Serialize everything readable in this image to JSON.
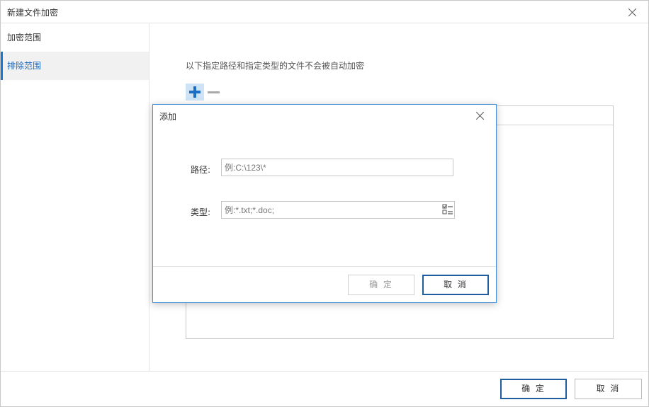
{
  "window": {
    "title": "新建文件加密"
  },
  "sidebar": {
    "items": [
      {
        "label": "加密范围"
      },
      {
        "label": "排除范围"
      }
    ]
  },
  "main": {
    "hint": "以下指定路径和指定类型的文件不会被自动加密"
  },
  "footer": {
    "ok_label": "确 定",
    "cancel_label": "取 消"
  },
  "dialog": {
    "title": "添加",
    "path_label": "路径:",
    "path_placeholder": "例:C:\\123\\*",
    "type_label": "类型:",
    "type_placeholder": "例:*.txt;*.doc;",
    "ok_label": "确 定",
    "cancel_label": "取 消"
  },
  "colors": {
    "accent": "#1976d2",
    "dialog_border": "#4a90d9",
    "add_icon": "#1c6ec4"
  },
  "icons": [
    "close-icon",
    "add-icon",
    "remove-icon",
    "checklist-icon"
  ]
}
